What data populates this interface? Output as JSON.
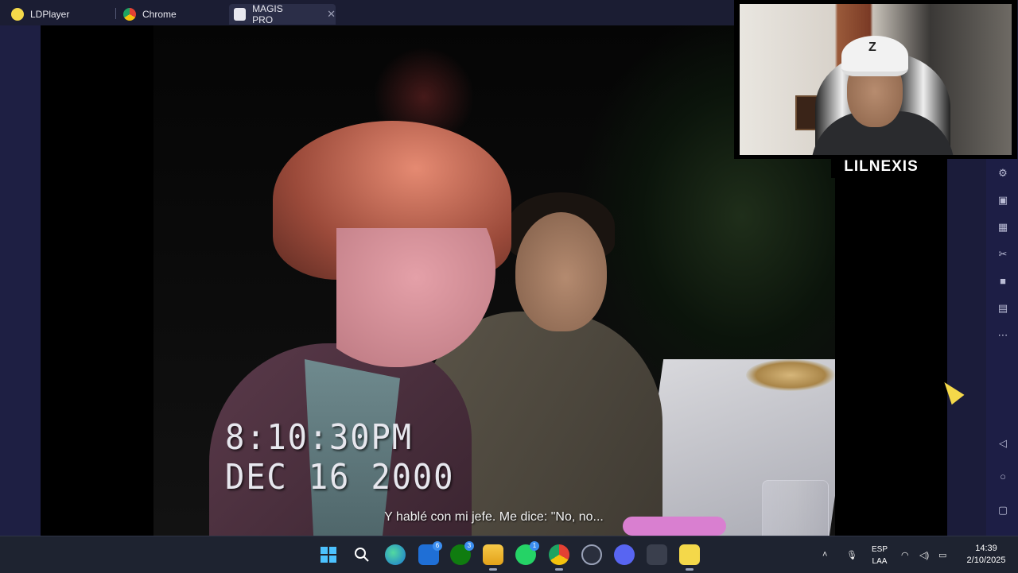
{
  "tabs": [
    {
      "label": "LDPlayer",
      "icon": "ldplayer-icon",
      "active": false
    },
    {
      "label": "Chrome",
      "icon": "chrome-icon",
      "active": false
    },
    {
      "label": "MAGIS PRO",
      "icon": "magis-pro-icon",
      "active": true
    }
  ],
  "video": {
    "timestamp_time": "8:10:30PM",
    "timestamp_date": "DEC 16 2000",
    "subtitle": "Y hablé con mi jefe. Me dice: \"No, no..."
  },
  "webcam": {
    "streamer_name": "LILNEXIS",
    "cap_letter": "Z"
  },
  "right_toolbar": [
    "gear-plus-icon",
    "window-icon",
    "robot-icon",
    "scissors-icon",
    "record-icon",
    "layers-icon",
    "more-icon",
    "back-icon",
    "home-icon",
    "recents-icon"
  ],
  "taskbar": {
    "apps": [
      {
        "name": "start-icon"
      },
      {
        "name": "search-icon"
      },
      {
        "name": "edge-icon"
      },
      {
        "name": "mail-icon",
        "badge": "6"
      },
      {
        "name": "xbox-icon",
        "badge": "3"
      },
      {
        "name": "file-explorer-icon"
      },
      {
        "name": "whatsapp-icon",
        "badge": "1"
      },
      {
        "name": "chrome-icon"
      },
      {
        "name": "steam-icon"
      },
      {
        "name": "discord-icon"
      },
      {
        "name": "media-icon"
      },
      {
        "name": "ldplayer-icon"
      }
    ],
    "lang_top": "ESP",
    "lang_bottom": "LAA",
    "time": "14:39",
    "date": "2/10/2025"
  },
  "colors": {
    "accent_yellow": "#f4d84a",
    "taskbar_bg": "#1e2330",
    "emulator_bg": "#1b1c3a"
  }
}
